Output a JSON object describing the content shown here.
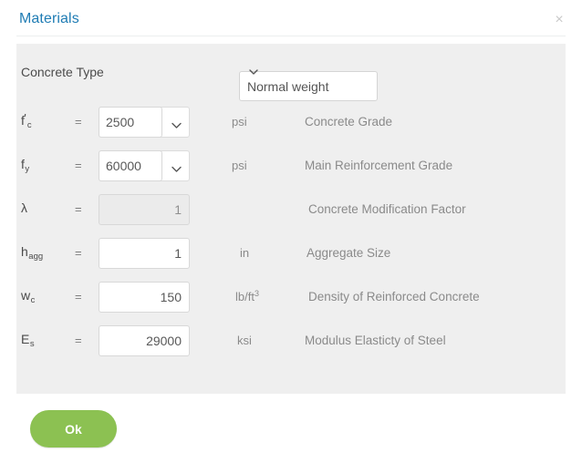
{
  "dialog": {
    "title": "Materials",
    "close_icon": "close-icon",
    "close_label": "×"
  },
  "concrete_type": {
    "label": "Concrete Type",
    "selected": "Normal weight",
    "options": [
      "Normal weight"
    ],
    "chevron_icon": "chevron-down-icon"
  },
  "rows": [
    {
      "symbol_base": "f",
      "symbol_prime": "'",
      "symbol_sub": "c",
      "equals": "=",
      "value": "2500",
      "control": "combo",
      "unit": "psi",
      "unit_sup": "",
      "description": "Concrete Grade",
      "disabled": false
    },
    {
      "symbol_base": "f",
      "symbol_prime": "",
      "symbol_sub": "y",
      "equals": "=",
      "value": "60000",
      "control": "combo",
      "unit": "psi",
      "unit_sup": "",
      "description": "Main Reinforcement Grade",
      "disabled": false
    },
    {
      "symbol_base": "λ",
      "symbol_prime": "",
      "symbol_sub": "",
      "equals": "=",
      "value": "1",
      "control": "text",
      "unit": "",
      "unit_sup": "",
      "description": "Concrete Modification Factor",
      "disabled": true
    },
    {
      "symbol_base": "h",
      "symbol_prime": "",
      "symbol_sub": "agg",
      "equals": "=",
      "value": "1",
      "control": "text",
      "unit": "in",
      "unit_sup": "",
      "description": "Aggregate Size",
      "disabled": false
    },
    {
      "symbol_base": "w",
      "symbol_prime": "",
      "symbol_sub": "c",
      "equals": "=",
      "value": "150",
      "control": "text",
      "unit": "lb/ft",
      "unit_sup": "3",
      "description": "Density of Reinforced Concrete",
      "disabled": false
    },
    {
      "symbol_base": "E",
      "symbol_prime": "",
      "symbol_sub": "s",
      "equals": "=",
      "value": "29000",
      "control": "text",
      "unit": "ksi",
      "unit_sup": "",
      "description": "Modulus Elasticty of Steel",
      "disabled": false
    }
  ],
  "footer": {
    "ok_label": "Ok"
  },
  "colors": {
    "title": "#1f7cb4",
    "panel": "#efefef",
    "ok_button": "#8cc152",
    "text": "#8a8a8a"
  }
}
